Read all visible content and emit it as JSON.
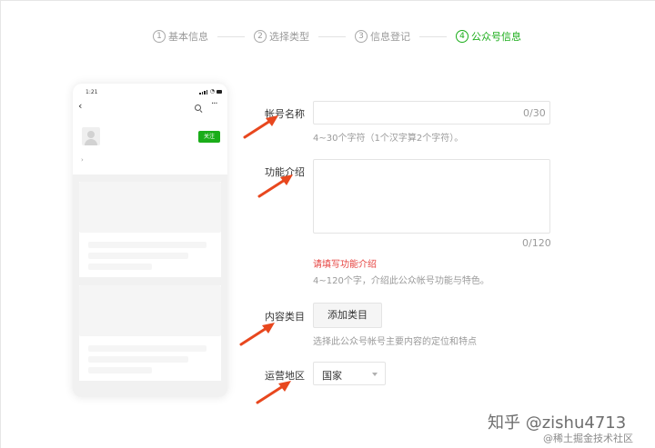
{
  "steps": [
    {
      "num": "1",
      "label": "基本信息",
      "active": false
    },
    {
      "num": "2",
      "label": "选择类型",
      "active": false
    },
    {
      "num": "3",
      "label": "信息登记",
      "active": false
    },
    {
      "num": "4",
      "label": "公众号信息",
      "active": true
    }
  ],
  "phone": {
    "time": "1:21",
    "follow_label": "关注",
    "profile_arrow": "›"
  },
  "form": {
    "account_name": {
      "label": "帐号名称",
      "value": "",
      "counter": "0/30",
      "hint": "4~30个字符（1个汉字算2个字符）。"
    },
    "intro": {
      "label": "功能介绍",
      "value": "",
      "counter": "0/120",
      "error": "请填写功能介绍",
      "hint": "4~120个字，介绍此公众帐号功能与特色。"
    },
    "category": {
      "label": "内容类目",
      "button_label": "添加类目",
      "hint": "选择此公众号帐号主要内容的定位和特点"
    },
    "region": {
      "label": "运营地区",
      "selected": "国家"
    }
  },
  "colors": {
    "accent": "#1aad19",
    "error": "#e64340",
    "arrow": "#e8471e"
  },
  "watermark": {
    "line1": "知乎 @zishu4713",
    "line2": "@稀土掘金技术社区"
  }
}
